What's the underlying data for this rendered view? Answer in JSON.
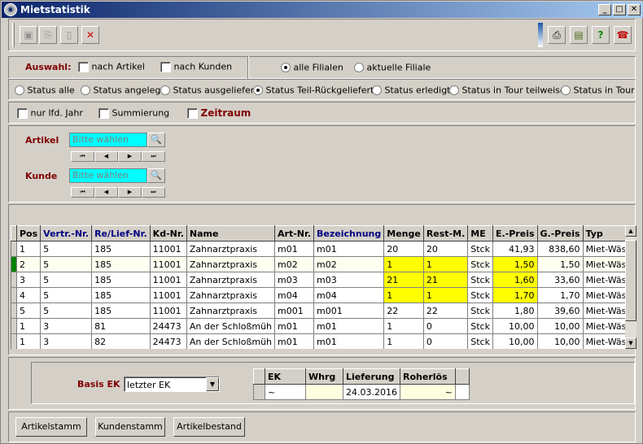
{
  "window": {
    "title": "Mietstatistik",
    "buttons": [
      "_",
      "□",
      "✕"
    ]
  },
  "toolbar": {
    "left_icons": [
      "save-icon",
      "copy-icon",
      "new-icon",
      "delete-icon"
    ],
    "right_icons": [
      "info-icon",
      "print-icon",
      "export-icon",
      "help-icon",
      "phone-icon"
    ]
  },
  "filter": {
    "auswahl_label": "Auswahl:",
    "nach_artikel": "nach Artikel",
    "nach_kunden": "nach Kunden",
    "alle_filialen": "alle Filialen",
    "aktuelle_filiale": "aktuelle Filiale",
    "status": [
      "Status alle",
      "Status angelegt",
      "Status ausgeliefert",
      "Status Teil-Rückgeliefert",
      "Status erledigt",
      "Status in Tour teilweise",
      "Status in Tour"
    ],
    "status_selected": 3,
    "nur_lfd_jahr": "nur lfd. Jahr",
    "summierung": "Summierung",
    "zeitraum": "Zeitraum"
  },
  "search": {
    "artikel_label": "Artikel",
    "kunde_label": "Kunde",
    "placeholder": "Bitte wählen"
  },
  "table": {
    "headers": [
      "Pos",
      "Vertr.-Nr.",
      "Re/Lief-Nr.",
      "Kd-Nr.",
      "Name",
      "Art-Nr.",
      "Bezeichnung",
      "Menge",
      "Rest-M.",
      "ME",
      "E.-Preis",
      "G.-Preis",
      "Typ"
    ],
    "rows": [
      [
        "1",
        "5",
        "185",
        "11001",
        "Zahnarztpraxis",
        "m01",
        "m01",
        "20",
        "20",
        "Stck",
        "41,93",
        "838,60",
        "Miet-Wäsc"
      ],
      [
        "2",
        "5",
        "185",
        "11001",
        "Zahnarztpraxis",
        "m02",
        "m02",
        "1",
        "1",
        "Stck",
        "1,50",
        "1,50",
        "Miet-Wäsc"
      ],
      [
        "3",
        "5",
        "185",
        "11001",
        "Zahnarztpraxis",
        "m03",
        "m03",
        "21",
        "21",
        "Stck",
        "1,60",
        "33,60",
        "Miet-Wäsc"
      ],
      [
        "4",
        "5",
        "185",
        "11001",
        "Zahnarztpraxis",
        "m04",
        "m04",
        "1",
        "1",
        "Stck",
        "1,70",
        "1,70",
        "Miet-Wäsc"
      ],
      [
        "5",
        "5",
        "185",
        "11001",
        "Zahnarztpraxis",
        "m001",
        "m001",
        "22",
        "22",
        "Stck",
        "1,80",
        "39,60",
        "Miet-Wäsc"
      ],
      [
        "1",
        "3",
        "81",
        "24473",
        "An der Schloßmüh",
        "m01",
        "m01",
        "1",
        "0",
        "Stck",
        "10,00",
        "10,00",
        "Miet-Wäsc"
      ],
      [
        "1",
        "3",
        "82",
        "24473",
        "An der Schloßmüh",
        "m01",
        "m01",
        "1",
        "0",
        "Stck",
        "10,00",
        "10,00",
        "Miet-Wäsc"
      ]
    ]
  },
  "basis": {
    "label": "Basis EK",
    "value": "letzter EK"
  },
  "ek_table": {
    "headers": [
      "EK",
      "Whrg",
      "Lieferung",
      "Roherlös"
    ],
    "row": [
      "~",
      "",
      "24.03.2016",
      "~"
    ]
  },
  "bottom_buttons": [
    "Artikelstamm",
    "Kundenstamm",
    "Artikelbestand"
  ]
}
